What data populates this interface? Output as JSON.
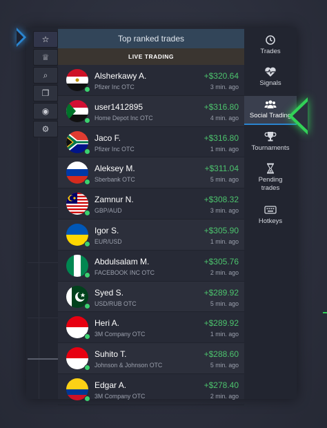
{
  "header": {
    "title": "Top ranked trades",
    "subtitle": "LIVE TRADING"
  },
  "left_toolbar": [
    {
      "icon": "star-icon",
      "glyph": "☆"
    },
    {
      "icon": "trophy-icon",
      "glyph": "♕"
    },
    {
      "icon": "search-icon",
      "glyph": "⌕"
    },
    {
      "icon": "copy-icon",
      "glyph": "❐"
    },
    {
      "icon": "eye-icon",
      "glyph": "◉"
    },
    {
      "icon": "gear-icon",
      "glyph": "⚙"
    }
  ],
  "right_nav": [
    {
      "label": "Trades",
      "icon": "history-icon"
    },
    {
      "label": "Signals",
      "icon": "heartbeat-icon"
    },
    {
      "label": "Social Trading",
      "icon": "users-icon",
      "active": true
    },
    {
      "label": "Tournaments",
      "icon": "trophy-icon"
    },
    {
      "label": "Pending trades",
      "icon": "hourglass-icon"
    },
    {
      "label": "Hotkeys",
      "icon": "keyboard-icon"
    }
  ],
  "trades": [
    {
      "name": "Alsherkawy A.",
      "asset": "Pfizer Inc OTC",
      "profit": "+$320.64",
      "time": "3 min. ago",
      "flag": "egypt"
    },
    {
      "name": "user1412895",
      "asset": "Home Depot Inc OTC",
      "profit": "+$316.80",
      "time": "4 min. ago",
      "flag": "sudan"
    },
    {
      "name": "Jaco F.",
      "asset": "Pfizer Inc OTC",
      "profit": "+$316.80",
      "time": "1 min. ago",
      "flag": "south-africa"
    },
    {
      "name": "Aleksey M.",
      "asset": "Sberbank OTC",
      "profit": "+$311.04",
      "time": "5 min. ago",
      "flag": "russia"
    },
    {
      "name": "Zamnur N.",
      "asset": "GBP/AUD",
      "profit": "+$308.32",
      "time": "3 min. ago",
      "flag": "malaysia"
    },
    {
      "name": "Igor S.",
      "asset": "EUR/USD",
      "profit": "+$305.90",
      "time": "1 min. ago",
      "flag": "ukraine"
    },
    {
      "name": "Abdulsalam M.",
      "asset": "FACEBOOK INC OTC",
      "profit": "+$305.76",
      "time": "2 min. ago",
      "flag": "nigeria"
    },
    {
      "name": "Syed S.",
      "asset": "USD/RUB OTC",
      "profit": "+$289.92",
      "time": "5 min. ago",
      "flag": "pakistan"
    },
    {
      "name": "Heri A.",
      "asset": "3M Company OTC",
      "profit": "+$289.92",
      "time": "1 min. ago",
      "flag": "indonesia"
    },
    {
      "name": "Suhito T.",
      "asset": "Johnson & Johnson OTC",
      "profit": "+$288.60",
      "time": "5 min. ago",
      "flag": "indonesia"
    },
    {
      "name": "Edgar A.",
      "asset": "3M Company OTC",
      "profit": "+$278.40",
      "time": "2 min. ago",
      "flag": "colombia"
    }
  ],
  "colors": {
    "profit": "#4cc36d",
    "online": "#3bd16f",
    "accent": "#2a85d0",
    "highlight_arrow": "#32d157"
  }
}
